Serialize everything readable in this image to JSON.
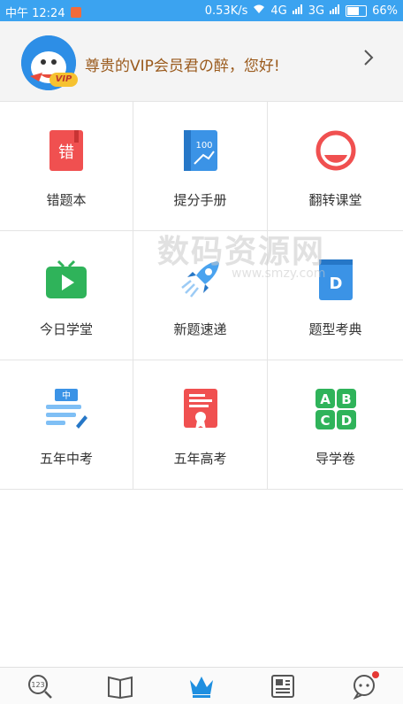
{
  "status": {
    "left_text": "中午 12:24",
    "speed": "0.53K/s",
    "net1": "4G",
    "net2": "3G",
    "battery": "66%"
  },
  "header": {
    "badge": "VIP",
    "greeting": "尊贵的VIP会员君の醉，您好!"
  },
  "watermark": {
    "main": "数码资源网",
    "sub": "www.smzy.com"
  },
  "grid": [
    {
      "label": "错题本",
      "icon": "error-book-icon",
      "glyph": "错"
    },
    {
      "label": "提分手册",
      "icon": "score-manual-icon",
      "glyph": "100"
    },
    {
      "label": "翻转课堂",
      "icon": "flip-class-icon"
    },
    {
      "label": "今日学堂",
      "icon": "tv-play-icon"
    },
    {
      "label": "新题速递",
      "icon": "rocket-icon"
    },
    {
      "label": "题型考典",
      "icon": "dictionary-icon",
      "glyph": "D"
    },
    {
      "label": "五年中考",
      "icon": "middle-exam-icon",
      "glyph": "中"
    },
    {
      "label": "五年高考",
      "icon": "certificate-icon"
    },
    {
      "label": "导学卷",
      "icon": "abcd-icon",
      "letters": [
        "A",
        "B",
        "C",
        "D"
      ]
    }
  ],
  "tabbar": {
    "tab1": {
      "icon": "search-123-icon",
      "glyph": "123"
    },
    "tab2": {
      "icon": "book-icon"
    },
    "tab3": {
      "icon": "crown-icon"
    },
    "tab4": {
      "icon": "news-icon"
    },
    "tab5": {
      "icon": "chat-icon"
    }
  },
  "colors": {
    "statusbar": "#3ba3f0",
    "accent": "#1e8fe0",
    "greeting": "#9a5a1c"
  }
}
